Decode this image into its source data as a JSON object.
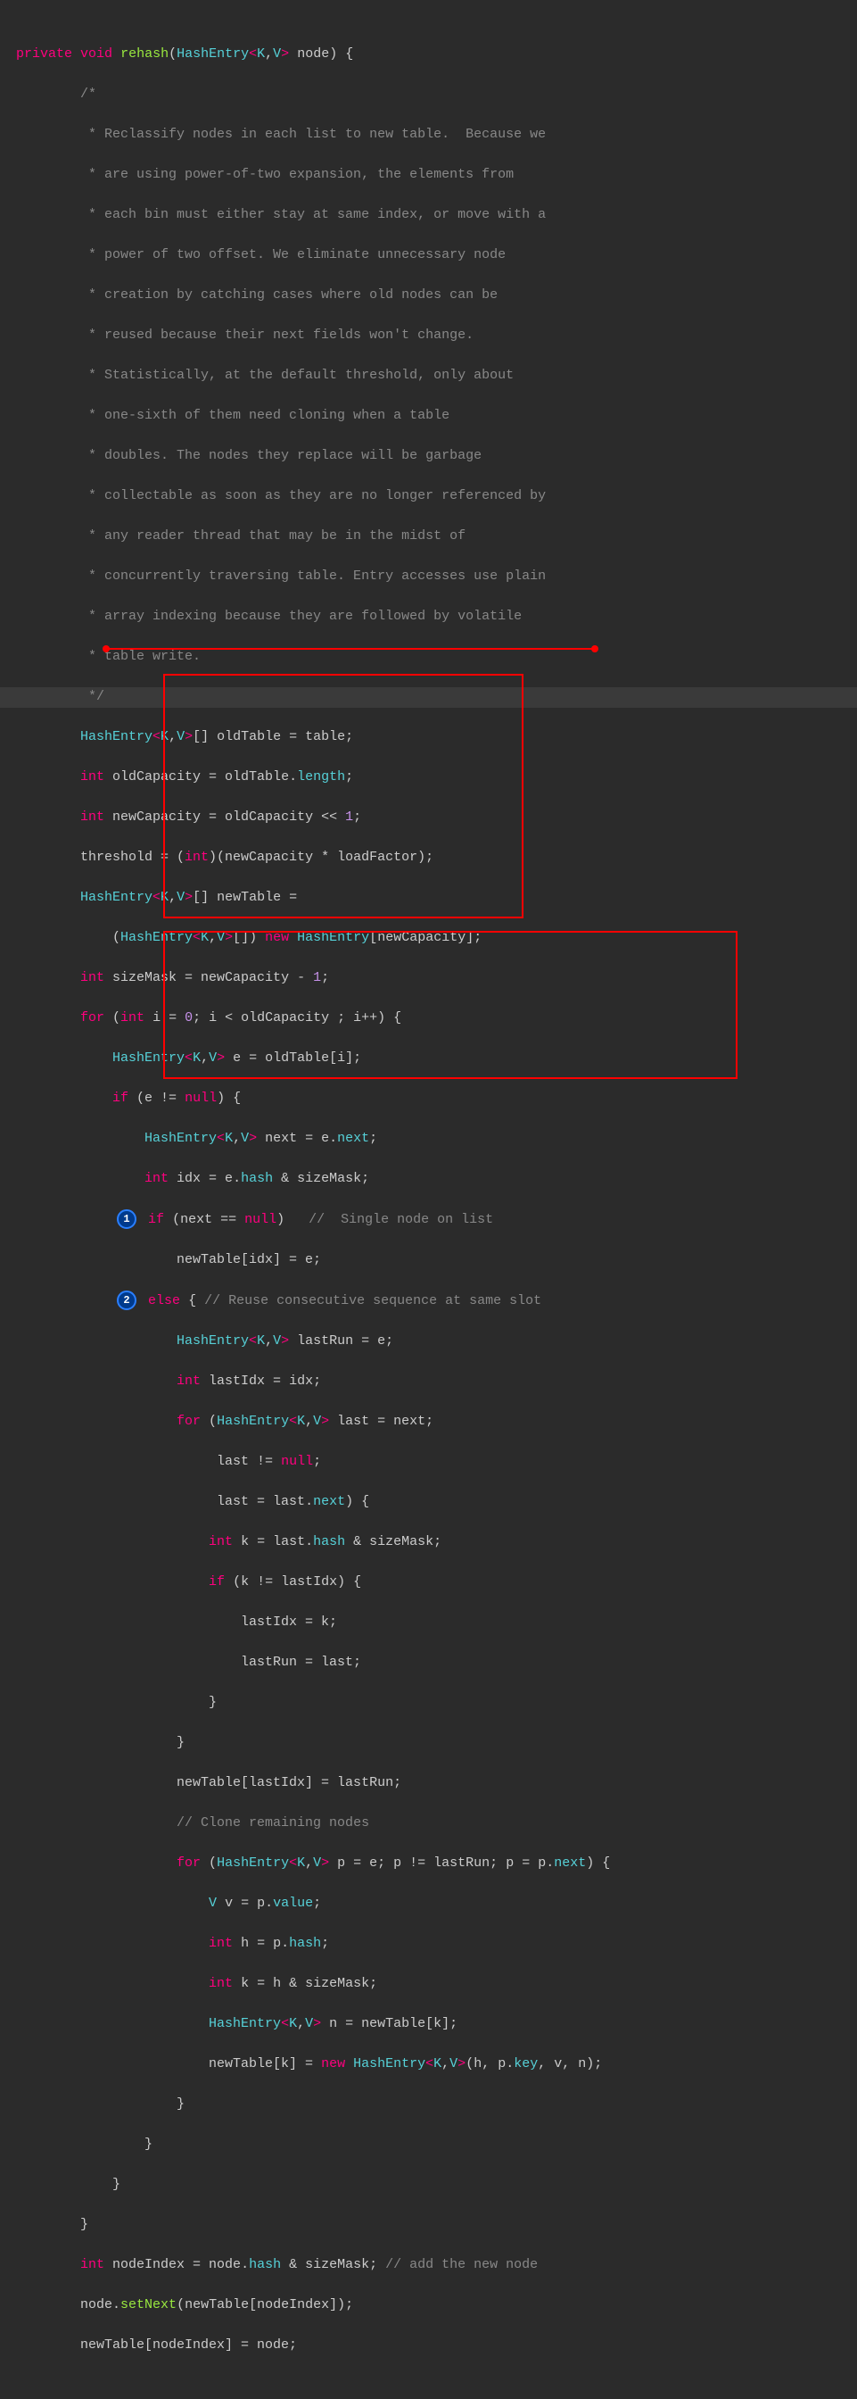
{
  "signature": {
    "private": "private",
    "void": "void",
    "method": "rehash",
    "cls": "HashEntry",
    "k": "K",
    "v": "V",
    "param": "node",
    "open": ") {"
  },
  "comment": [
    "        /*",
    "         * Reclassify nodes in each list to new table.  Because we",
    "         * are using power-of-two expansion, the elements from",
    "         * each bin must either stay at same index, or move with a",
    "         * power of two offset. We eliminate unnecessary node",
    "         * creation by catching cases where old nodes can be",
    "         * reused because their next fields won't change.",
    "         * Statistically, at the default threshold, only about",
    "         * one-sixth of them need cloning when a table",
    "         * doubles. The nodes they replace will be garbage",
    "         * collectable as soon as they are no longer referenced by",
    "         * any reader thread that may be in the midst of",
    "         * concurrently traversing table. Entry accesses use plain",
    "         * array indexing because they are followed by volatile",
    "         * table write.",
    "         */"
  ],
  "body": {
    "l1_a": "        ",
    "l1_cls": "HashEntry",
    "l1_gk": "K",
    "l1_gv": "V",
    "l1_b": "[] oldTable = table;",
    "l2_a": "        ",
    "l2_kw": "int",
    "l2_b": " oldCapacity = oldTable",
    "l2_c": ".",
    "l2_len": "length",
    "l2_d": ";",
    "l3_a": "        ",
    "l3_kw": "int",
    "l3_b": " newCapacity = oldCapacity << ",
    "l3_num": "1",
    "l3_c": ";",
    "l4_a": "        threshold = (",
    "l4_kw": "int",
    "l4_b": ")(newCapacity * loadFactor);",
    "l5_a": "        ",
    "l5_cls": "HashEntry",
    "l5_gk": "K",
    "l5_gv": "V",
    "l5_b": "[] newTable =",
    "l6_a": "            (",
    "l6_cls": "HashEntry",
    "l6_gk": "K",
    "l6_gv": "V",
    "l6_b": "[]) ",
    "l6_kw": "new",
    "l6_c": " ",
    "l6_cls2": "HashEntry",
    "l6_d": "[newCapacity];",
    "l7_a": "        ",
    "l7_kw": "int",
    "l7_b": " sizeMask = newCapacity - ",
    "l7_num": "1",
    "l7_c": ";",
    "l8_a": "        ",
    "l8_for": "for",
    "l8_b": " (",
    "l8_int": "int",
    "l8_c": " i = ",
    "l8_n0": "0",
    "l8_d": "; i < oldCapacity ; i++) {",
    "l9_a": "            ",
    "l9_cls": "HashEntry",
    "l9_gk": "K",
    "l9_gv": "V",
    "l9_b": " e = oldTable[i];",
    "l10_a": "            ",
    "l10_if": "if",
    "l10_b": " (e != ",
    "l10_null": "null",
    "l10_c": ") {",
    "l11_a": "                ",
    "l11_cls": "HashEntry",
    "l11_gk": "K",
    "l11_gv": "V",
    "l11_b": " next = e",
    "l11_c": ".",
    "l11_p": "next",
    "l11_d": ";",
    "l12_a": "                ",
    "l12_kw": "int",
    "l12_b": " idx = e",
    "l12_c": ".",
    "l12_p": "hash",
    "l12_d": " & sizeMask;",
    "l13_a": "             ",
    "l13_if": "if",
    "l13_b": " (next == ",
    "l13_null": "null",
    "l13_c": ")   ",
    "l13_cm": "//  Single node on list",
    "l14": "                    newTable[idx] = e;",
    "l15_a": "             ",
    "l15_else": "else",
    "l15_b": " { ",
    "l15_cm": "// Reuse consecutive sequence at same slot",
    "l16_a": "                    ",
    "l16_cls": "HashEntry",
    "l16_gk": "K",
    "l16_gv": "V",
    "l16_b": " lastRun = e;",
    "l17_a": "                    ",
    "l17_kw": "int",
    "l17_b": " lastIdx = idx;",
    "l18_a": "                    ",
    "l18_for": "for",
    "l18_b": " (",
    "l18_cls": "HashEntry",
    "l18_gk": "K",
    "l18_gv": "V",
    "l18_c": " last = next;",
    "l19_a": "                         last != ",
    "l19_null": "null",
    "l19_b": ";",
    "l20_a": "                         last = last",
    "l20_b": ".",
    "l20_p": "next",
    "l20_c": ") {",
    "l21_a": "                        ",
    "l21_kw": "int",
    "l21_b": " k = last",
    "l21_c": ".",
    "l21_p": "hash",
    "l21_d": " & sizeMask;",
    "l22_a": "                        ",
    "l22_if": "if",
    "l22_b": " (k != lastIdx) {",
    "l23": "                            lastIdx = k;",
    "l24": "                            lastRun = last;",
    "l25": "                        }",
    "l26": "                    }",
    "l27": "                    newTable[lastIdx] = lastRun;",
    "l28_a": "                    ",
    "l28_cm": "// Clone remaining nodes",
    "l29_a": "                    ",
    "l29_for": "for",
    "l29_b": " (",
    "l29_cls": "HashEntry",
    "l29_gk": "K",
    "l29_gv": "V",
    "l29_c": " p = e; p != lastRun; p = p",
    "l29_d": ".",
    "l29_p": "next",
    "l29_e": ") {",
    "l30_a": "                        ",
    "l30_cls": "V",
    "l30_b": " v = p",
    "l30_c": ".",
    "l30_p": "value",
    "l30_d": ";",
    "l31_a": "                        ",
    "l31_kw": "int",
    "l31_b": " h = p",
    "l31_c": ".",
    "l31_p": "hash",
    "l31_d": ";",
    "l32_a": "                        ",
    "l32_kw": "int",
    "l32_b": " k = h & sizeMask;",
    "l33_a": "                        ",
    "l33_cls": "HashEntry",
    "l33_gk": "K",
    "l33_gv": "V",
    "l33_b": " n = newTable[k];",
    "l34_a": "                        newTable[k] = ",
    "l34_kw": "new",
    "l34_b": " ",
    "l34_cls": "HashEntry",
    "l34_gk": "K",
    "l34_gv": "V",
    "l34_c": "(h, p",
    "l34_d": ".",
    "l34_p": "key",
    "l34_e": ", v, n);",
    "l35": "                    }",
    "l36": "                }",
    "l37": "            }",
    "l38": "        }",
    "l39_a": "        ",
    "l39_kw": "int",
    "l39_b": " nodeIndex = node",
    "l39_c": ".",
    "l39_p": "hash",
    "l39_d": " & sizeMask; ",
    "l39_cm": "// add the new node",
    "l40_a": "        node",
    "l40_b": ".",
    "l40_m": "setNext",
    "l40_c": "(newTable[nodeIndex]);",
    "l41": "        newTable[nodeIndex] = node;"
  },
  "badges": {
    "b1": "1",
    "b2": "2"
  }
}
